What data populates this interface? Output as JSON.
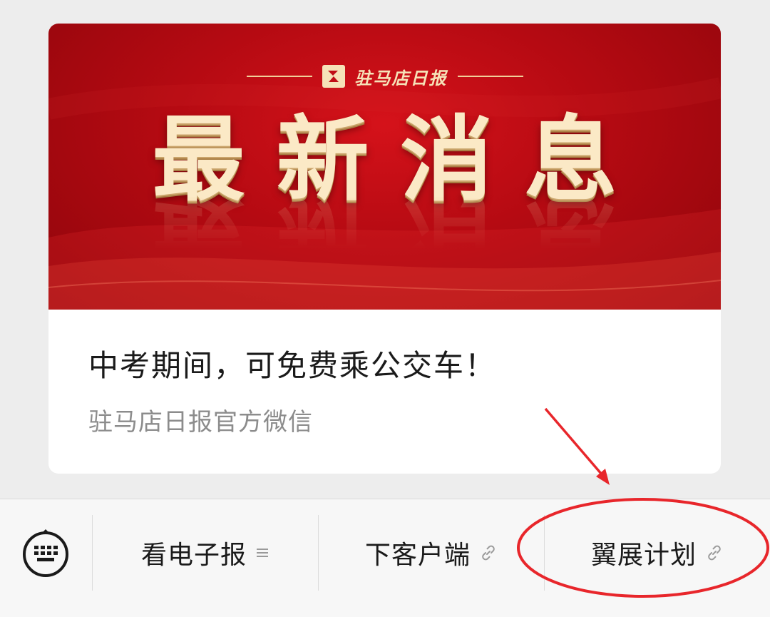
{
  "card": {
    "banner": {
      "brand_name": "驻马店日报",
      "headline": "最新消息"
    },
    "title": "中考期间，可免费乘公交车！",
    "source": "驻马店日报官方微信"
  },
  "menu": {
    "keyboard_icon": "keyboard-icon",
    "items": [
      {
        "label": "看电子报",
        "icon": "submenu-lines-icon"
      },
      {
        "label": "下客户端",
        "icon": "link-icon"
      },
      {
        "label": "翼展计划",
        "icon": "link-icon"
      }
    ]
  },
  "annotation": {
    "color": "#e8262b",
    "shape": "ellipse-with-arrow",
    "target": "翼展计划"
  },
  "colors": {
    "banner_red": "#c00d15",
    "headline_gold": "#fbe9c6",
    "page_bg": "#ededed"
  }
}
